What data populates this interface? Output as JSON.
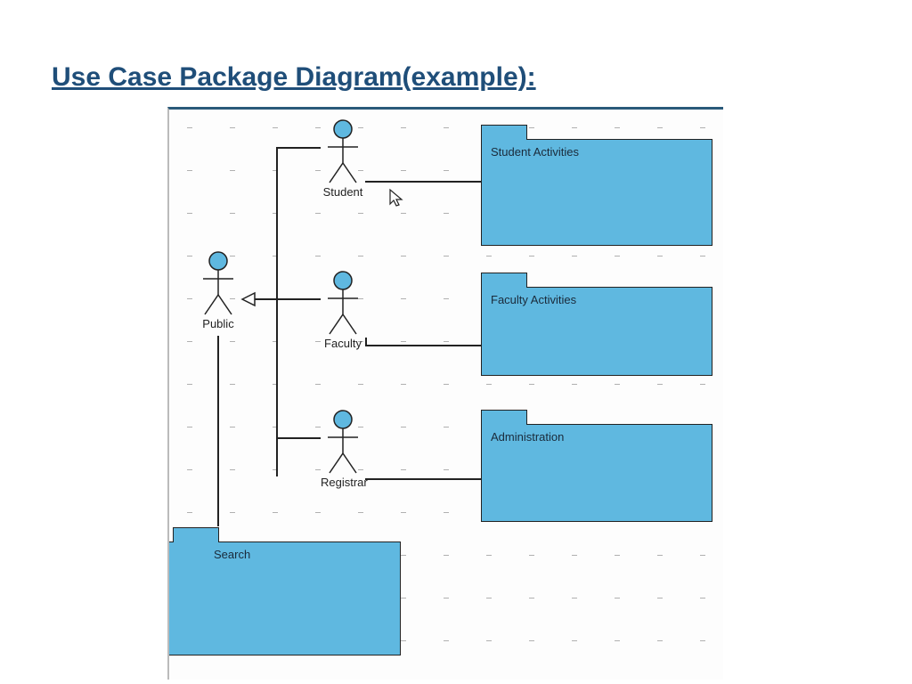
{
  "title": "Use Case Package Diagram(example):",
  "actors": {
    "student": "Student",
    "public": "Public",
    "faculty": "Faculty",
    "registrar": "Registrar"
  },
  "packages": {
    "student_activities": "Student Activities",
    "faculty_activities": "Faculty Activities",
    "administration": "Administration",
    "search": "Search"
  },
  "colors": {
    "accent": "#5fb8e0",
    "title": "#1f4e79"
  }
}
